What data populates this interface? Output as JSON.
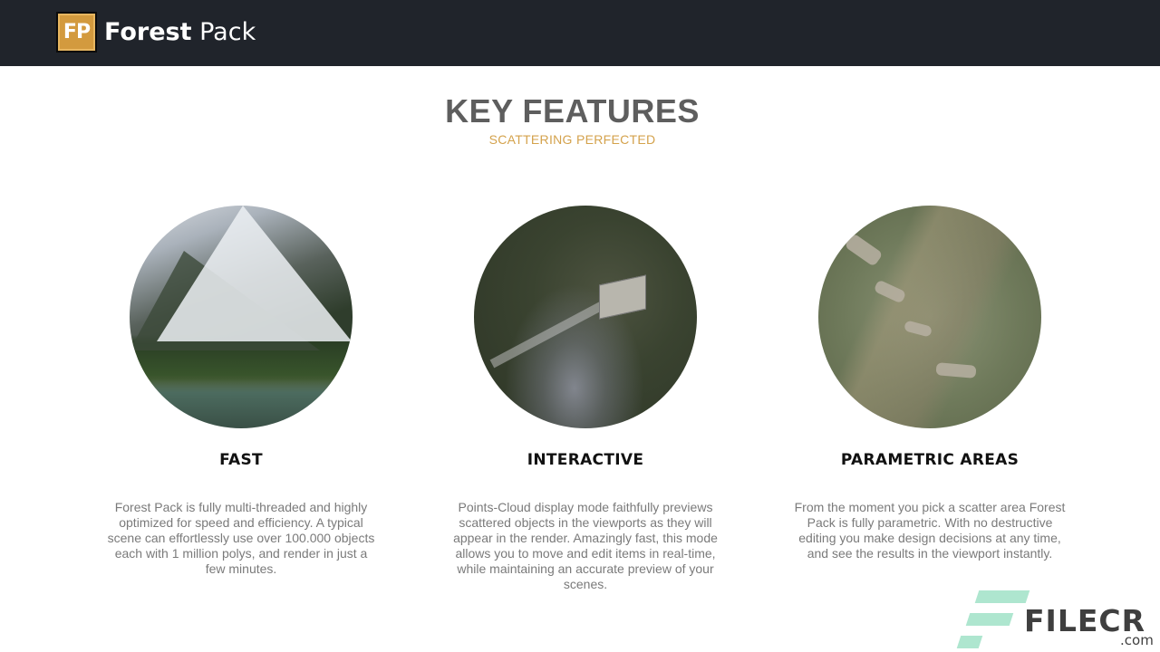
{
  "header": {
    "logo_badge": "FP",
    "brand_first": "Forest",
    "brand_second": "Pack"
  },
  "section": {
    "title": "KEY FEATURES",
    "subtitle": "SCATTERING PERFECTED"
  },
  "features": [
    {
      "heading": "FAST",
      "description": "Forest Pack is fully multi-threaded and highly optimized for speed and efficiency. A typical scene can effortlessly use over 100.000 objects each with 1 million polys, and render in just a few minutes."
    },
    {
      "heading": "INTERACTIVE",
      "description": "Points-Cloud display mode faithfully previews scattered objects in the viewports as they will appear in the render. Amazingly fast, this mode allows you to move and edit items in real-time, while maintaining an accurate preview of your scenes."
    },
    {
      "heading": "PARAMETRIC AREAS",
      "description": "From the moment you pick a scatter area Forest Pack is fully parametric. With no destructive editing you make design decisions at any time, and see the results in the viewport instantly."
    }
  ],
  "watermark": {
    "brand": "FILECR",
    "domain": ".com"
  },
  "colors": {
    "header_bg": "#20242b",
    "accent_gold": "#d4a24c",
    "watermark_mint": "#aee6cf"
  }
}
